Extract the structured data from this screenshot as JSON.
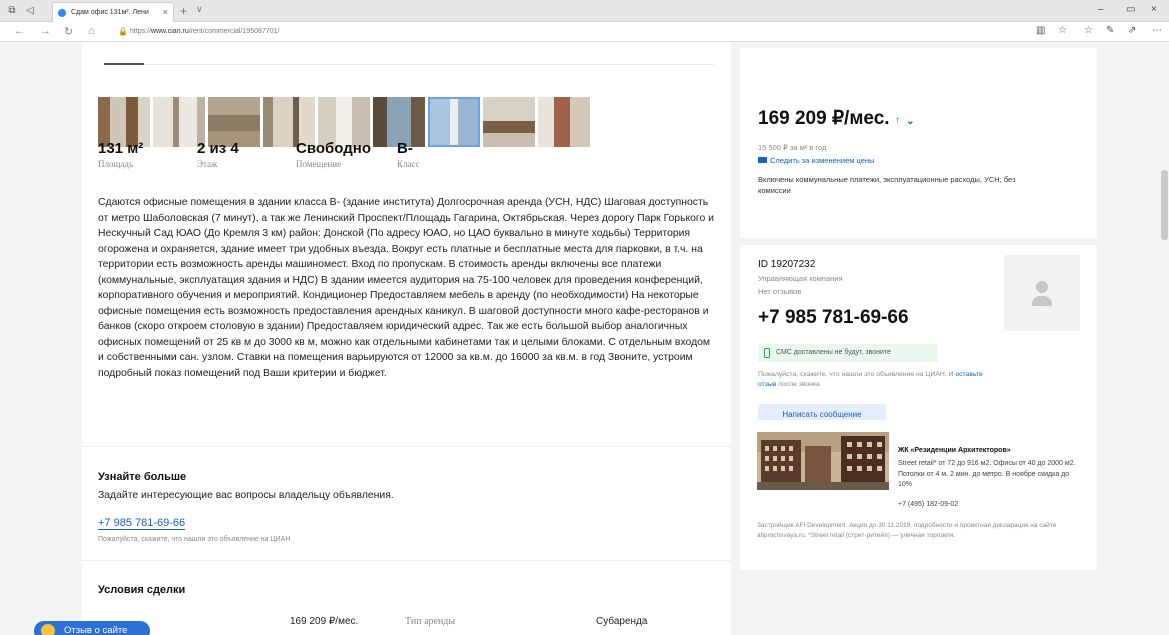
{
  "browser": {
    "tab_title": "Сдам офис 131м². Лени",
    "url_prefix": "https://",
    "url_domain": "www.cian.ru",
    "url_path": "/rent/commercial/195087701/"
  },
  "listing": {
    "stats": [
      {
        "value": "131 м²",
        "label": "Площадь"
      },
      {
        "value": "2 из 4",
        "label": "Этаж"
      },
      {
        "value": "Свободно",
        "label": "Помещение"
      },
      {
        "value": "B-",
        "label": "Класс"
      }
    ],
    "description": "Сдаются офисные помещения в здании класса B- (здание института) Долгосрочная аренда (УСН, НДС) Шаговая доступность от метро Шаболовская (7 минут), а так же Ленинский Проспект/Площадь Гагарина, Октябрьская. Через дорогу Парк Горького и Нескучный Сад ЮАО (До Кремля 3 км) район: Донской (По адресу ЮАО, но ЦАО буквально в минуте ходьбы) Территория огорожена и охраняется, здание имеет три удобных въезда. Вокруг есть платные и бесплатные места для парковки, в т.ч. на территории есть возможность аренды машиномест. Вход по пропускам. В стоимость аренды включены все платежи (коммунальные, эксплуатация здания и НДС) В здании имеется аудитория на 75-100 человек для проведения конференций, корпоративного обучения и мероприятий. Кондиционер Предоставляем мебель в аренду (по необходимости) На некоторые офисные помещения есть возможность предоставления арендных каникул. В шаговой доступности много кафе-ресторанов и банков (скоро откроем столовую в здании) Предоставляем юридический адрес. Так же есть большой выбор аналогичных офисных помещений от 25 кв м до 3000 кв м, можно как отдельными кабинетами так и целыми блоками. С отдельным входом и собственными сан. узлом. Ставки на помещения варьируются от 12000 за кв.м. до 16000 за кв.м. в год Звоните, устроим подробный показ помещений под Ваши критерии и бюджет."
  },
  "learn_more": {
    "title": "Узнайте больше",
    "subtitle": "Задайте интересующие вас вопросы владельцу объявления.",
    "phone": "+7 985 781-69-66",
    "note": "Пожалуйста, скажите, что нашли это объявление на ЦИАН"
  },
  "deal": {
    "title": "Условия сделки",
    "price": "169 209 ₽/мес.",
    "rent_type_label": "Тип аренды",
    "rent_type_value": "Субаренда"
  },
  "feedback_label": "Отзыв о сайте",
  "price_card": {
    "price": "169 209 ₽/мес.",
    "per_m2": "15 500 ₽ за м² в год",
    "follow": "Следить за изменением цены",
    "included": "Включены коммунальные платежи, эксплуатационные расходы, УСН; без комиссии"
  },
  "agent_card": {
    "id": "ID 19207232",
    "role": "Управляющая компания",
    "reviews": "Нет отзывов",
    "phone": "+7 985 781-69-66",
    "sms": "СМС доставлены не будут, звоните",
    "please_prefix": "Пожалуйста, скажите, что нашли это объявление на ЦИАН. И ",
    "please_link": "оставьте отзыв",
    "please_suffix": " после звонка",
    "write_button": "Написать сообщение"
  },
  "ad": {
    "title": "ЖК «Резиденции Архитекторов»",
    "text": "Street retail* от 72 до 916 м2. Офисы от 40 до 2000 м2. Потолки от 4 м. 2 мин. до метро. В ноябре скидка до 10%",
    "phone": "+7 (495) 182-09-02",
    "footer": "Застройщик AFI Development. Акция до 30.11.2019, подробности и проектная декларация на сайте afiprochsvaya.ru. *Street retail (стрит-ритейл) — уличная торговля."
  },
  "colors": {
    "accent": "#1a5fc4",
    "price_up": "#2ca24c",
    "feedback": "#2c6fd6"
  }
}
